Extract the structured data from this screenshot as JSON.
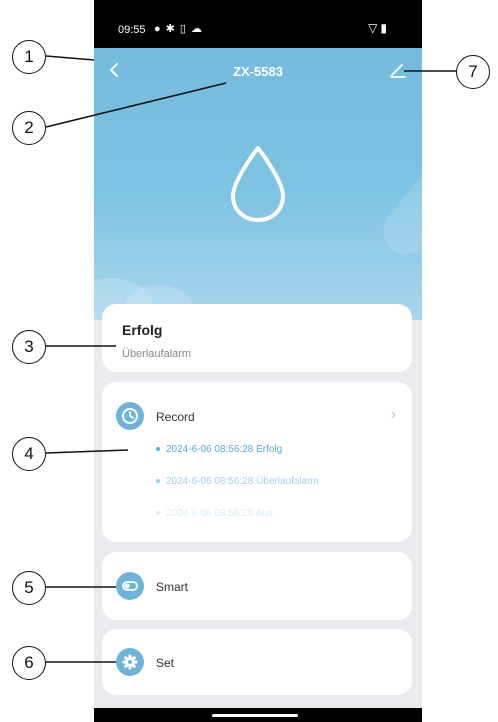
{
  "status_bar": {
    "time": "09:55"
  },
  "header": {
    "title": "ZX-5583"
  },
  "status_card": {
    "headline": "Erfolg",
    "subtitle": "Überlaufalarm"
  },
  "record": {
    "label": "Record",
    "items": [
      {
        "text": "2024-6-06 08:56:28 Erfolg",
        "color": "#5aa9d6"
      },
      {
        "text": "2024-6-06 08:56:28 Überlaufalarm",
        "color": "#a6d0e6"
      },
      {
        "text": "2024-6-06 08:56:28 Aus",
        "color": "#dbeaf3"
      }
    ]
  },
  "smart": {
    "label": "Smart"
  },
  "set": {
    "label": "Set"
  },
  "callouts": [
    "1",
    "2",
    "3",
    "4",
    "5",
    "6",
    "7"
  ],
  "colors": {
    "accent": "#6fb4d8",
    "hero": "#7ec3e3",
    "background": "#e9eaee"
  }
}
